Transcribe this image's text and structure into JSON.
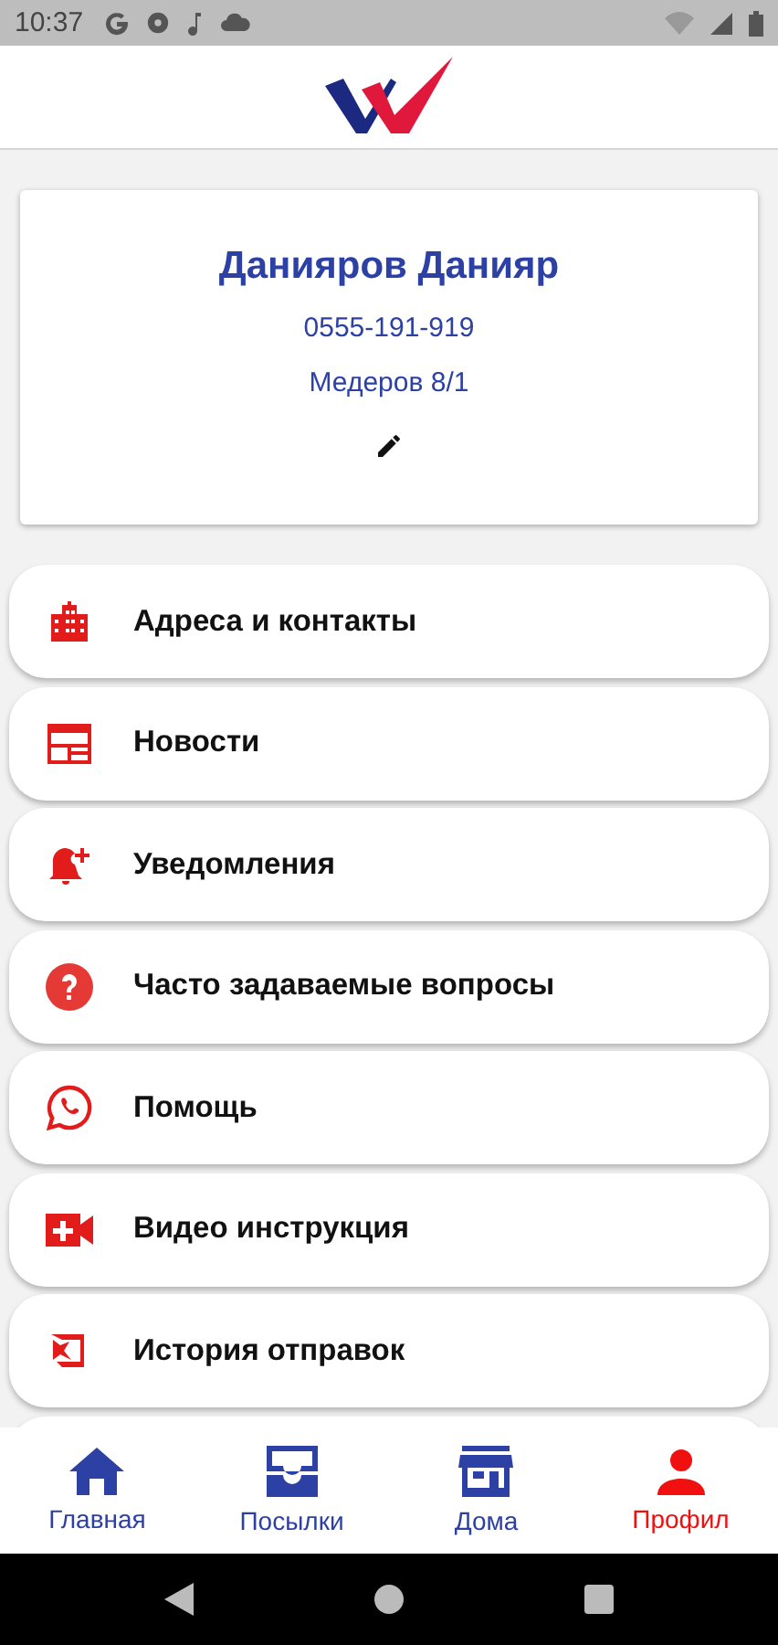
{
  "status_bar": {
    "time": "10:37"
  },
  "profile": {
    "name": "Данияров Данияр",
    "phone": "0555-191-919",
    "address": "Медеров 8/1"
  },
  "menu": [
    {
      "label": "Адреса и контакты"
    },
    {
      "label": "Новости"
    },
    {
      "label": "Уведомления"
    },
    {
      "label": "Часто задаваемые вопросы"
    },
    {
      "label": "Помощь"
    },
    {
      "label": "Видео инструкция"
    },
    {
      "label": "История отправок"
    }
  ],
  "bottom_nav": [
    {
      "label": "Главная",
      "selected": false
    },
    {
      "label": "Посылки",
      "selected": false
    },
    {
      "label": "Дома",
      "selected": false
    },
    {
      "label": "Профил",
      "selected": true
    }
  ]
}
